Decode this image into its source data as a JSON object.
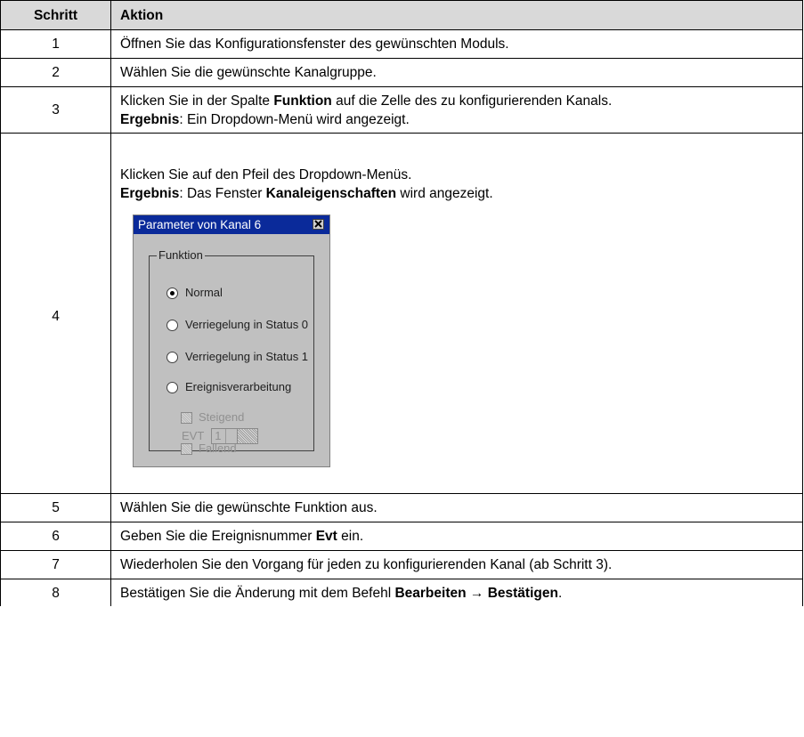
{
  "header": {
    "col_step": "Schritt",
    "col_action": "Aktion"
  },
  "rows": [
    {
      "step": "1",
      "text": "Öffnen Sie das Konfigurationsfenster des gewünschten Moduls."
    },
    {
      "step": "2",
      "text": "Wählen Sie die gewünschte Kanalgruppe."
    },
    {
      "step": "3",
      "line1_a": "Klicken Sie in der Spalte ",
      "line1_bold": "Funktion",
      "line1_b": " auf die Zelle des zu konfigurierenden Kanals.",
      "line2_bold": "Ergebnis",
      "line2_rest": ": Ein Dropdown-Menü wird angezeigt."
    },
    {
      "step": "4",
      "line1": "Klicken Sie auf den Pfeil des Dropdown-Menüs.",
      "line2_bold": "Ergebnis",
      "line2_a": ": Das Fenster ",
      "line2_bold2": "Kanaleigenschaften",
      "line2_b": " wird angezeigt."
    },
    {
      "step": "5",
      "text": "Wählen Sie die gewünschte Funktion aus."
    },
    {
      "step": "6",
      "text_a": "Geben Sie die Ereignisnummer ",
      "text_bold": "Evt",
      "text_b": " ein."
    },
    {
      "step": "7",
      "text": "Wiederholen Sie den Vorgang für jeden zu konfigurierenden Kanal (ab Schritt 3)."
    },
    {
      "step": "8",
      "text_a": "Bestätigen Sie die Änderung mit dem Befehl ",
      "text_bold": "Bearbeiten → Bestätigen",
      "text_b": "."
    }
  ],
  "dialog": {
    "title": "Parameter von Kanal 6",
    "group_label": "Funktion",
    "options": [
      "Normal",
      "Verriegelung in Status 0",
      "Verriegelung in Status 1",
      "Ereignisverarbeitung"
    ],
    "selected_option": "Normal",
    "checkboxes": [
      "Steigend",
      "Fallend"
    ],
    "evt_label": "EVT",
    "evt_value": "1"
  }
}
